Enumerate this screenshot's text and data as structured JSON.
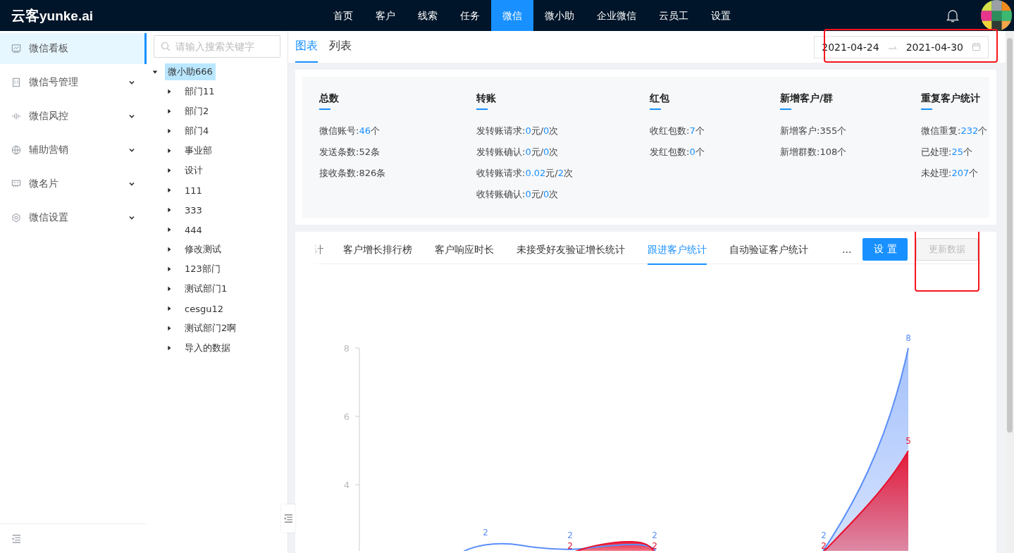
{
  "header": {
    "logo_cn": "云客",
    "logo_en": "yunke.ai",
    "nav": [
      {
        "label": "首页",
        "selected": false
      },
      {
        "label": "客户",
        "selected": false
      },
      {
        "label": "线索",
        "selected": false
      },
      {
        "label": "任务",
        "selected": false
      },
      {
        "label": "微信",
        "selected": true
      },
      {
        "label": "微小助",
        "selected": false
      },
      {
        "label": "企业微信",
        "selected": false
      },
      {
        "label": "云员工",
        "selected": false
      },
      {
        "label": "设置",
        "selected": false
      }
    ]
  },
  "sidebar": {
    "items": [
      {
        "label": "微信看板",
        "selected": true,
        "expandable": false
      },
      {
        "label": "微信号管理",
        "selected": false,
        "expandable": true
      },
      {
        "label": "微信风控",
        "selected": false,
        "expandable": true
      },
      {
        "label": "辅助营销",
        "selected": false,
        "expandable": true
      },
      {
        "label": "微名片",
        "selected": false,
        "expandable": true
      },
      {
        "label": "微信设置",
        "selected": false,
        "expandable": true
      }
    ]
  },
  "tree": {
    "search": {
      "placeholder": "请输入搜索关键字"
    },
    "nodes": [
      {
        "label": "微小助666",
        "selected": true,
        "expanded": true,
        "children": [
          {
            "label": "部门11",
            "expanded": false
          },
          {
            "label": "部门2",
            "expanded": false
          },
          {
            "label": "部门4",
            "expanded": false
          },
          {
            "label": "事业部",
            "expanded": false
          },
          {
            "label": "设计",
            "expanded": false
          },
          {
            "label": "111",
            "expanded": false
          },
          {
            "label": "333",
            "expanded": false
          },
          {
            "label": "444",
            "expanded": false
          },
          {
            "label": "修改测试",
            "expanded": false
          },
          {
            "label": "123部门",
            "expanded": false
          },
          {
            "label": "测试部门1",
            "expanded": false
          },
          {
            "label": "cesgu12",
            "expanded": false
          },
          {
            "label": "测试部门2啊",
            "expanded": false
          },
          {
            "label": "导入的数据",
            "expanded": false
          }
        ]
      }
    ]
  },
  "view_tabs": [
    {
      "label": "图表",
      "selected": true
    },
    {
      "label": "列表",
      "selected": false
    }
  ],
  "date_range": {
    "start": "2021-04-24",
    "end": "2021-04-30",
    "highlighted": true
  },
  "stats": [
    {
      "title": "总数",
      "lines": [
        [
          {
            "text": "微信账号:"
          },
          {
            "text": "46",
            "kind": "value"
          },
          {
            "text": "个"
          }
        ],
        [
          {
            "text": "发送条数:52条"
          }
        ],
        [
          {
            "text": "接收条数:826条"
          }
        ]
      ]
    },
    {
      "title": "转账",
      "lines": [
        [
          {
            "text": "发转账请求:"
          },
          {
            "text": "0",
            "kind": "value"
          },
          {
            "text": "元/"
          },
          {
            "text": "0",
            "kind": "value"
          },
          {
            "text": "次"
          }
        ],
        [
          {
            "text": "发转账确认:"
          },
          {
            "text": "0",
            "kind": "value"
          },
          {
            "text": "元/"
          },
          {
            "text": "0",
            "kind": "value"
          },
          {
            "text": "次"
          }
        ],
        [
          {
            "text": "收转账请求:"
          },
          {
            "text": "0.02",
            "kind": "value"
          },
          {
            "text": "元/"
          },
          {
            "text": "2",
            "kind": "value"
          },
          {
            "text": "次"
          }
        ],
        [
          {
            "text": "收转账确认:"
          },
          {
            "text": "0",
            "kind": "value"
          },
          {
            "text": "元/"
          },
          {
            "text": "0",
            "kind": "value"
          },
          {
            "text": "次"
          }
        ]
      ]
    },
    {
      "title": "红包",
      "lines": [
        [
          {
            "text": "收红包数:"
          },
          {
            "text": "7",
            "kind": "value"
          },
          {
            "text": "个"
          }
        ],
        [
          {
            "text": "发红包数:"
          },
          {
            "text": "0",
            "kind": "value"
          },
          {
            "text": "个"
          }
        ]
      ]
    },
    {
      "title": "新增客户/群",
      "lines": [
        [
          {
            "text": "新增客户:355个"
          }
        ],
        [
          {
            "text": "新增群数:108个"
          }
        ]
      ]
    },
    {
      "title": "重复客户统计",
      "lines": [
        [
          {
            "text": "微信重复:"
          },
          {
            "text": "232",
            "kind": "value"
          },
          {
            "text": "个"
          }
        ],
        [
          {
            "text": "已处理:"
          },
          {
            "text": "25",
            "kind": "value"
          },
          {
            "text": "个"
          }
        ],
        [
          {
            "text": "未处理:"
          },
          {
            "text": "207",
            "kind": "value"
          },
          {
            "text": "个"
          }
        ]
      ]
    }
  ],
  "chart_tabs": [
    {
      "label": "计",
      "selected": false
    },
    {
      "label": "客户增长排行榜",
      "selected": false
    },
    {
      "label": "客户响应时长",
      "selected": false
    },
    {
      "label": "未接受好友验证增长统计",
      "selected": false
    },
    {
      "label": "跟进客户统计",
      "selected": true
    },
    {
      "label": "自动验证客户统计",
      "selected": false
    }
  ],
  "more": "...",
  "settings_button": "设 置",
  "update_button": {
    "label": "更新数据",
    "disabled": true,
    "highlighted": true
  },
  "chart": {
    "kind": "picture",
    "y_labels": [
      "8",
      "6",
      "4"
    ],
    "series": [
      {
        "color": "#5b8ff9",
        "point_labels": [
          "2",
          "2",
          "2",
          "2",
          "8"
        ]
      },
      {
        "color": "#e8102e",
        "point_labels": [
          "2",
          "2",
          "2",
          "5"
        ]
      }
    ]
  }
}
